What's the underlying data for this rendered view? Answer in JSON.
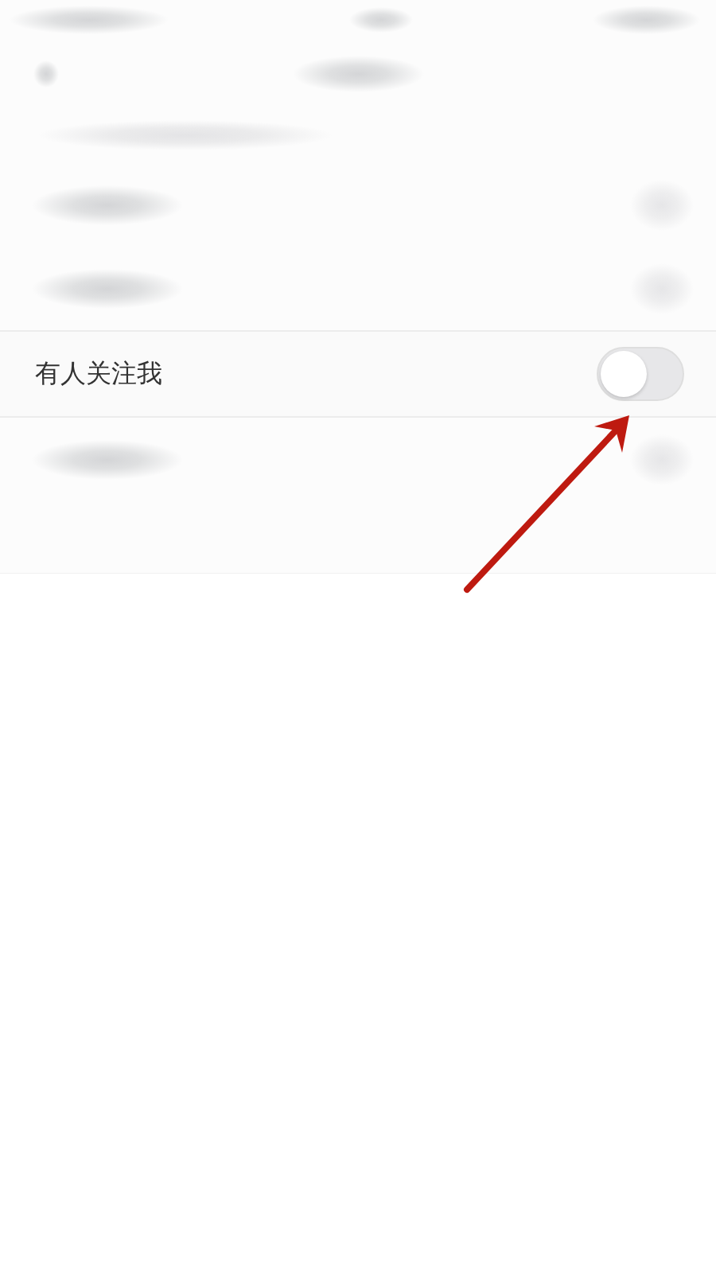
{
  "settings": [
    {
      "kind": "blurred"
    },
    {
      "kind": "blurred"
    },
    {
      "kind": "toggle",
      "label": "有人关注我",
      "on": false
    },
    {
      "kind": "blurred"
    }
  ]
}
